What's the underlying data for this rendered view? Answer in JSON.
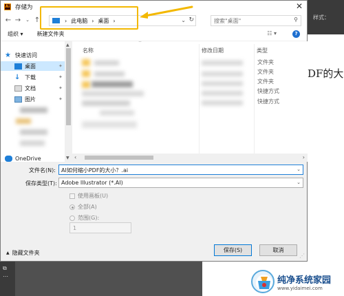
{
  "dialog": {
    "app_icon_text": "Ai",
    "title": "存储为",
    "close_glyph": "✕"
  },
  "nav": {
    "back": "←",
    "forward": "→",
    "up": "↑",
    "dropdown": "⌄",
    "breadcrumb": [
      "此电脑",
      "桌面"
    ],
    "crumb_sep": "›",
    "refresh": "↻",
    "search_placeholder": "搜索\"桌面\"",
    "search_icon": "⚲"
  },
  "commands": {
    "organize": "组织 ▾",
    "new_folder": "新建文件夹",
    "view_icon": "☷ ▾",
    "help": "?"
  },
  "sidebar": {
    "items": [
      {
        "label": "快速访问",
        "icon": "star-icon"
      },
      {
        "label": "桌面",
        "icon": "desktop-icon"
      },
      {
        "label": "下载",
        "icon": "download-icon"
      },
      {
        "label": "文档",
        "icon": "document-icon"
      },
      {
        "label": "图片",
        "icon": "picture-icon"
      },
      {
        "label": "OneDrive",
        "icon": "cloud-icon"
      }
    ],
    "pin_glyph": "📌"
  },
  "files": {
    "columns": [
      "名称",
      "修改日期",
      "类型"
    ],
    "types": [
      "文件夹",
      "文件夹",
      "文件夹",
      "快捷方式",
      "快捷方式"
    ]
  },
  "form": {
    "filename_label": "文件名(N):",
    "filename_value": "AI如何缩小PDF的大小？.ai",
    "filetype_label": "保存类型(T):",
    "filetype_value": "Adobe Illustrator (*.AI)",
    "use_artboards": "使用画板(U)",
    "all": "全部(A)",
    "range": "范围(G):",
    "range_value": "1"
  },
  "footer": {
    "hide_folders": "隐藏文件夹",
    "save": "保存(S)",
    "cancel": "取消"
  },
  "background": {
    "toolbar_text": "样式：",
    "doc_text": "DF的大"
  },
  "watermark": {
    "name": "纯净系统家园",
    "url": "www.yidaimei.com"
  },
  "colors": {
    "accent": "#0078d7",
    "highlight_box": "#f3b800",
    "folder": "#f5c65a"
  }
}
